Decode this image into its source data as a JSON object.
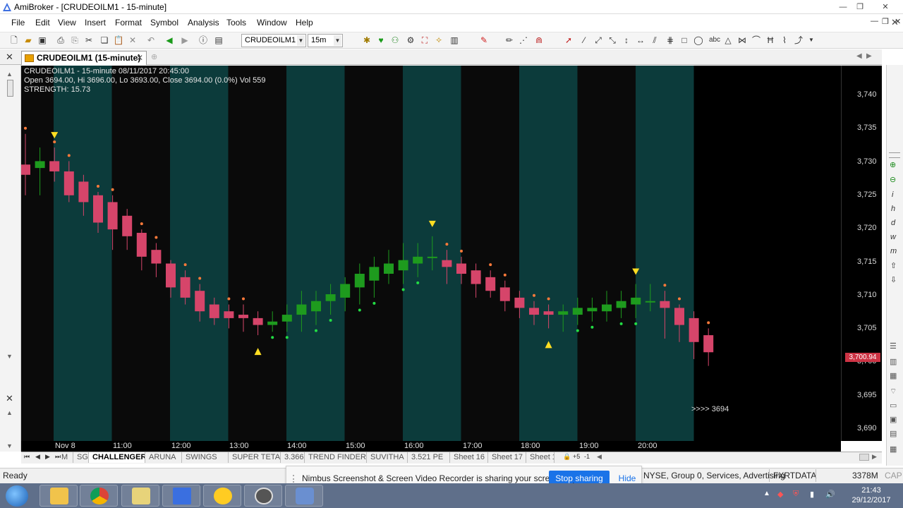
{
  "window": {
    "title": "AmiBroker - [CRUDEOILM1 -  15-minute]",
    "controls": [
      "—",
      "❐",
      "✕"
    ]
  },
  "menu": [
    "File",
    "Edit",
    "View",
    "Insert",
    "Format",
    "Symbol",
    "Analysis",
    "Tools",
    "Window",
    "Help"
  ],
  "toolbar": {
    "symbol_value": "CRUDEOILM1",
    "interval_value": "15m"
  },
  "doc_tab": {
    "title": "CRUDEOILM1 (15-minute)",
    "close": "✕"
  },
  "chart": {
    "info_line1": "CRUDEOILM1 - 15-minute 08/11/2017 20:45:00",
    "info_line2": "Open 3694.00, Hi 3696.00, Lo 3693.00, Close 3694.00 (0.0%) Vol 559",
    "info_line3": "STRENGTH: 15.73",
    "last_label": ">>>>  3694",
    "price_badge": "3,700.94",
    "y_ticks": [
      "3,740",
      "3,735",
      "3,730",
      "3,725",
      "3,720",
      "3,715",
      "3,710",
      "3,705",
      "3,700",
      "3,695",
      "3,690"
    ],
    "x_ticks": [
      "Nov 8",
      "11:00",
      "12:00",
      "13:00",
      "14:00",
      "15:00",
      "16:00",
      "17:00",
      "18:00",
      "19:00",
      "20:00"
    ],
    "colors": {
      "up": "#1e9b1e",
      "down": "#d6456a",
      "band": "#0c3b3b",
      "dark": "#0a0a0a"
    }
  },
  "chart_data": {
    "type": "candlestick",
    "symbol": "CRUDEOILM1",
    "interval": "15-minute",
    "ylim": [
      3688,
      3743
    ],
    "x": [
      "Nov 8",
      "11:00",
      "12:00",
      "13:00",
      "14:00",
      "15:00",
      "16:00",
      "17:00",
      "18:00",
      "19:00",
      "20:00"
    ],
    "candles": [
      {
        "o": 3728.5,
        "h": 3733,
        "l": 3724,
        "c": 3727
      },
      {
        "o": 3728,
        "h": 3731,
        "l": 3724,
        "c": 3729
      },
      {
        "o": 3729,
        "h": 3731,
        "l": 3726,
        "c": 3727.5
      },
      {
        "o": 3727.5,
        "h": 3729,
        "l": 3723,
        "c": 3724
      },
      {
        "o": 3726,
        "h": 3727,
        "l": 3721,
        "c": 3723
      },
      {
        "o": 3724,
        "h": 3724.5,
        "l": 3718.5,
        "c": 3720
      },
      {
        "o": 3723,
        "h": 3724,
        "l": 3716,
        "c": 3719
      },
      {
        "o": 3721,
        "h": 3722,
        "l": 3716,
        "c": 3718
      },
      {
        "o": 3718.5,
        "h": 3719,
        "l": 3713,
        "c": 3715
      },
      {
        "o": 3716,
        "h": 3717,
        "l": 3712,
        "c": 3714
      },
      {
        "o": 3714,
        "h": 3714.5,
        "l": 3709,
        "c": 3710.5
      },
      {
        "o": 3712,
        "h": 3713,
        "l": 3708,
        "c": 3709
      },
      {
        "o": 3710,
        "h": 3711,
        "l": 3705.5,
        "c": 3707
      },
      {
        "o": 3708,
        "h": 3709,
        "l": 3705,
        "c": 3706
      },
      {
        "o": 3707,
        "h": 3708,
        "l": 3704.5,
        "c": 3706
      },
      {
        "o": 3706.5,
        "h": 3708,
        "l": 3704,
        "c": 3706
      },
      {
        "o": 3706,
        "h": 3707,
        "l": 3703.5,
        "c": 3705
      },
      {
        "o": 3705,
        "h": 3707,
        "l": 3704,
        "c": 3705.5
      },
      {
        "o": 3705.5,
        "h": 3708,
        "l": 3704,
        "c": 3706.5
      },
      {
        "o": 3706.5,
        "h": 3710,
        "l": 3704,
        "c": 3708
      },
      {
        "o": 3707,
        "h": 3710,
        "l": 3705,
        "c": 3708.5
      },
      {
        "o": 3708.5,
        "h": 3711,
        "l": 3706.5,
        "c": 3709.5
      },
      {
        "o": 3709,
        "h": 3712,
        "l": 3707,
        "c": 3711
      },
      {
        "o": 3710.5,
        "h": 3714,
        "l": 3708,
        "c": 3712.5
      },
      {
        "o": 3711.5,
        "h": 3715,
        "l": 3709,
        "c": 3713.5
      },
      {
        "o": 3712.5,
        "h": 3716,
        "l": 3711,
        "c": 3714
      },
      {
        "o": 3713,
        "h": 3717,
        "l": 3711,
        "c": 3714.5
      },
      {
        "o": 3714,
        "h": 3717,
        "l": 3712,
        "c": 3715
      },
      {
        "o": 3715,
        "h": 3718,
        "l": 3713,
        "c": 3715
      },
      {
        "o": 3714.5,
        "h": 3716,
        "l": 3711,
        "c": 3713.5
      },
      {
        "o": 3714,
        "h": 3715,
        "l": 3711,
        "c": 3712.5
      },
      {
        "o": 3713,
        "h": 3714,
        "l": 3709,
        "c": 3711
      },
      {
        "o": 3712,
        "h": 3713,
        "l": 3709,
        "c": 3710
      },
      {
        "o": 3710.5,
        "h": 3711.5,
        "l": 3707,
        "c": 3708.5
      },
      {
        "o": 3709,
        "h": 3710,
        "l": 3706,
        "c": 3707.5
      },
      {
        "o": 3707.5,
        "h": 3708.5,
        "l": 3705,
        "c": 3706.5
      },
      {
        "o": 3707,
        "h": 3708,
        "l": 3704.5,
        "c": 3706.5
      },
      {
        "o": 3706.5,
        "h": 3708,
        "l": 3704,
        "c": 3707
      },
      {
        "o": 3706.5,
        "h": 3709,
        "l": 3705,
        "c": 3707.5
      },
      {
        "o": 3707,
        "h": 3709,
        "l": 3705.5,
        "c": 3707.5
      },
      {
        "o": 3707,
        "h": 3710,
        "l": 3705.5,
        "c": 3708
      },
      {
        "o": 3707.5,
        "h": 3710,
        "l": 3706,
        "c": 3708.5
      },
      {
        "o": 3708,
        "h": 3711,
        "l": 3706,
        "c": 3709
      },
      {
        "o": 3708.5,
        "h": 3711,
        "l": 3707,
        "c": 3708.5
      },
      {
        "o": 3708.5,
        "h": 3710,
        "l": 3703,
        "c": 3707.5
      },
      {
        "o": 3707.5,
        "h": 3708,
        "l": 3702.5,
        "c": 3705
      },
      {
        "o": 3706,
        "h": 3707,
        "l": 3700,
        "c": 3702.5
      },
      {
        "o": 3703.5,
        "h": 3704.5,
        "l": 3699,
        "c": 3701
      }
    ],
    "signals": [
      {
        "i": 2,
        "type": "sell"
      },
      {
        "i": 16,
        "type": "buy"
      },
      {
        "i": 28,
        "type": "sell"
      },
      {
        "i": 36,
        "type": "buy"
      },
      {
        "i": 42,
        "type": "sell"
      }
    ]
  },
  "sheets": [
    "M",
    "SG",
    "CHALLENGER",
    "ARUNA",
    "SWINGS",
    "SUPER TETA",
    "3.366",
    "TREND FINDER",
    "SUVITHA",
    "3.521 PE",
    "Sheet 16",
    "Sheet 17",
    "Sheet 1"
  ],
  "active_sheet": "CHALLENGER",
  "status": {
    "ready": "Ready",
    "info": "NYSE, Group 0, Services, Advertising",
    "source": "FXRTDATA",
    "memory": "3378M",
    "cap": "CAP"
  },
  "share_banner": {
    "message": "Nimbus Screenshot & Screen Video Recorder is sharing your screen.",
    "stop": "Stop sharing",
    "hide": "Hide"
  },
  "clock": {
    "time": "21:43",
    "date": "29/12/2017"
  }
}
